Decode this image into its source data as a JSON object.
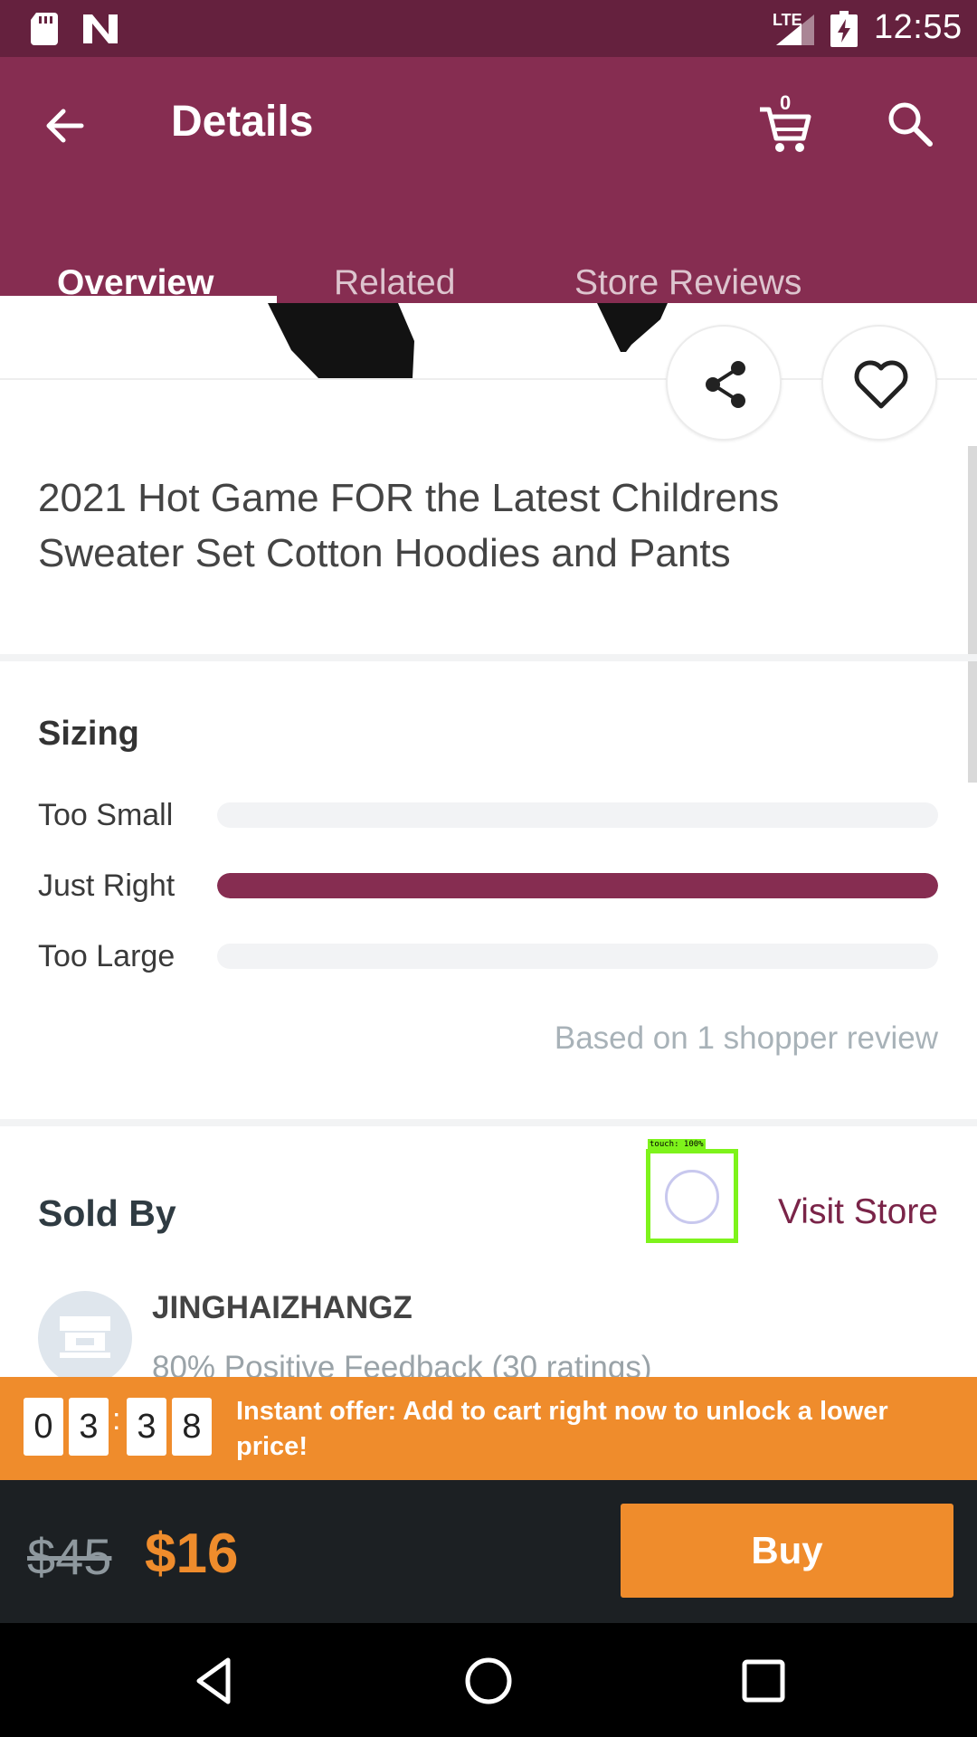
{
  "status_bar": {
    "network": "LTE",
    "time": "12:55"
  },
  "app_bar": {
    "title": "Details",
    "cart_count": "0"
  },
  "tabs": [
    {
      "label": "Overview",
      "active": true
    },
    {
      "label": "Related",
      "active": false
    },
    {
      "label": "Store Reviews",
      "active": false
    }
  ],
  "product": {
    "title": "2021 Hot Game FOR the Latest Childrens Sweater Set Cotton Hoodies and Pants"
  },
  "sizing": {
    "heading": "Sizing",
    "rows": [
      {
        "label": "Too Small",
        "fraction": 0.0
      },
      {
        "label": "Just Right",
        "fraction": 1.0
      },
      {
        "label": "Too Large",
        "fraction": 0.0
      }
    ],
    "based_on": "Based on 1 shopper review"
  },
  "seller": {
    "heading": "Sold By",
    "visit_store_label": "Visit Store",
    "touch_label": "touch: 100%",
    "store_name": "JINGHAIZHANGZ",
    "feedback": "80% Positive Feedback (30 ratings)"
  },
  "offer": {
    "timer_digits": [
      "0",
      "3",
      "3",
      "8"
    ],
    "separator": ":",
    "text": "Instant offer: Add to cart right now to unlock a lower price!"
  },
  "buy_bar": {
    "old_price": "$45",
    "new_price": "$16",
    "buy_label": "Buy"
  },
  "colors": {
    "primary": "#862d51",
    "status_bar": "#65213e",
    "accent": "#ef8c2c",
    "dark_bar": "#1c2023"
  }
}
